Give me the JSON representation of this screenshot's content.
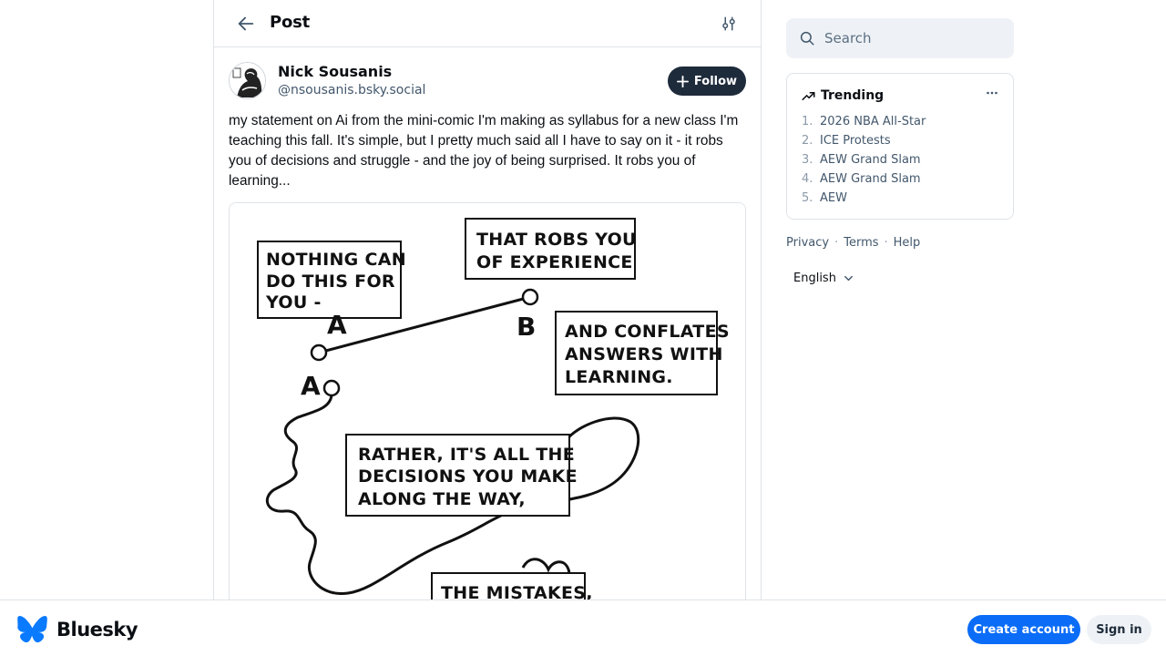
{
  "header": {
    "title": "Post",
    "back_icon": "arrow-left-icon",
    "filter_icon": "sliders-icon"
  },
  "post": {
    "author_name": "Nick Sousanis",
    "author_handle": "@nsousanis.bsky.social",
    "follow_label": "Follow",
    "text": "my statement on Ai from the mini-comic I'm making as syllabus for a new class I'm teaching this fall. It's simple, but I pretty much said all I have to say on it - it robs you of decisions and struggle - and the joy of being surprised. It robs you of learning...",
    "comic": {
      "panel1": [
        "NOTHING CAN",
        "DO THIS FOR",
        "YOU -"
      ],
      "panel2": [
        "THAT ROBS YOU",
        "OF EXPERIENCE"
      ],
      "panel3": [
        "AND CONFLATES",
        "ANSWERS WITH",
        "LEARNING."
      ],
      "panel4": [
        "RATHER, IT'S ALL THE",
        "DECISIONS YOU MAKE",
        "ALONG THE WAY,"
      ],
      "panel5": [
        "THE MISTAKES,"
      ],
      "label_a1": "A",
      "label_b": "B",
      "label_a2": "A"
    }
  },
  "sidebar": {
    "search_placeholder": "Search",
    "trending_title": "Trending",
    "trending_items": [
      {
        "rank": "1.",
        "label": "2026 NBA All-Star"
      },
      {
        "rank": "2.",
        "label": "ICE Protests"
      },
      {
        "rank": "3.",
        "label": "AEW Grand Slam"
      },
      {
        "rank": "4.",
        "label": "AEW Grand Slam"
      },
      {
        "rank": "5.",
        "label": "AEW"
      }
    ],
    "footer_links": {
      "privacy": "Privacy",
      "terms": "Terms",
      "help": "Help",
      "separator": "·"
    },
    "language": "English"
  },
  "bottom_bar": {
    "brand": "Bluesky",
    "create_account": "Create account",
    "sign_in": "Sign in"
  },
  "colors": {
    "accent": "#0a6cf7",
    "follow_button": "#1e2b3b",
    "muted_text": "#42576c",
    "border": "#dfe3e8"
  }
}
